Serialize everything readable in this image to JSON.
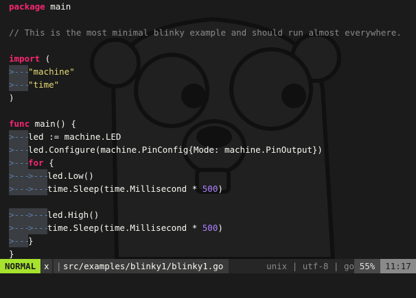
{
  "editor": {
    "lines": [
      [
        {
          "t": "package",
          "c": "kw"
        },
        {
          "t": " main"
        }
      ],
      [],
      [
        {
          "t": "// This is the most minimal blinky example and should run almost everywhere.",
          "c": "cmt"
        }
      ],
      [],
      [
        {
          "t": "import",
          "c": "kw"
        },
        {
          "t": " ("
        }
      ],
      [
        {
          "t": ">---",
          "c": "tab"
        },
        {
          "t": "\"machine\"",
          "c": "str"
        }
      ],
      [
        {
          "t": ">---",
          "c": "tab"
        },
        {
          "t": "\"time\"",
          "c": "str"
        }
      ],
      [
        {
          "t": ")"
        }
      ],
      [],
      [
        {
          "t": "func",
          "c": "kw"
        },
        {
          "t": " main() {"
        }
      ],
      [
        {
          "t": ">---",
          "c": "tab"
        },
        {
          "t": "led := machine.LED"
        }
      ],
      [
        {
          "t": ">---",
          "c": "tab"
        },
        {
          "t": "led.Configure(machine.PinConfig{Mode: machine.PinOutput})"
        }
      ],
      [
        {
          "t": ">---",
          "c": "tab"
        },
        {
          "t": "for",
          "c": "kw"
        },
        {
          "t": " {"
        }
      ],
      [
        {
          "t": ">---",
          "c": "tab"
        },
        {
          "t": ">---",
          "c": "tab"
        },
        {
          "t": "led.Low()"
        }
      ],
      [
        {
          "t": ">---",
          "c": "tab"
        },
        {
          "t": ">---",
          "c": "tab"
        },
        {
          "t": "time.Sleep(time.Millisecond * "
        },
        {
          "t": "500",
          "c": "num"
        },
        {
          "t": ")"
        }
      ],
      [],
      [
        {
          "t": ">---",
          "c": "tab"
        },
        {
          "t": ">---",
          "c": "tab"
        },
        {
          "t": "led.High()"
        }
      ],
      [
        {
          "t": ">---",
          "c": "tab"
        },
        {
          "t": ">---",
          "c": "tab"
        },
        {
          "t": "time.Sleep(time.Millisecond * "
        },
        {
          "t": "500",
          "c": "num"
        },
        {
          "t": ")"
        }
      ],
      [
        {
          "t": ">---",
          "c": "tab"
        },
        {
          "t": "}"
        }
      ],
      [
        {
          "t": "}"
        }
      ]
    ],
    "colors": {
      "background": "#1b1b1b",
      "keyword": "#f92672",
      "comment": "#8a8a8a",
      "string": "#e6db74",
      "number": "#ae81ff",
      "tab_marker_bg": "#3a3d41"
    },
    "watermark": "gopher-mascot"
  },
  "statusline": {
    "mode": "NORMAL",
    "modified_flag": "x",
    "separator": "|",
    "filepath": "src/examples/blinky1/blinky1.go",
    "fileformat": "unix",
    "encoding": "utf-8",
    "filetype": "go",
    "right_info": "unix | utf-8 | go",
    "percent": "55%",
    "position": "11:17",
    "colors": {
      "mode_bg": "#a6e22e"
    }
  }
}
